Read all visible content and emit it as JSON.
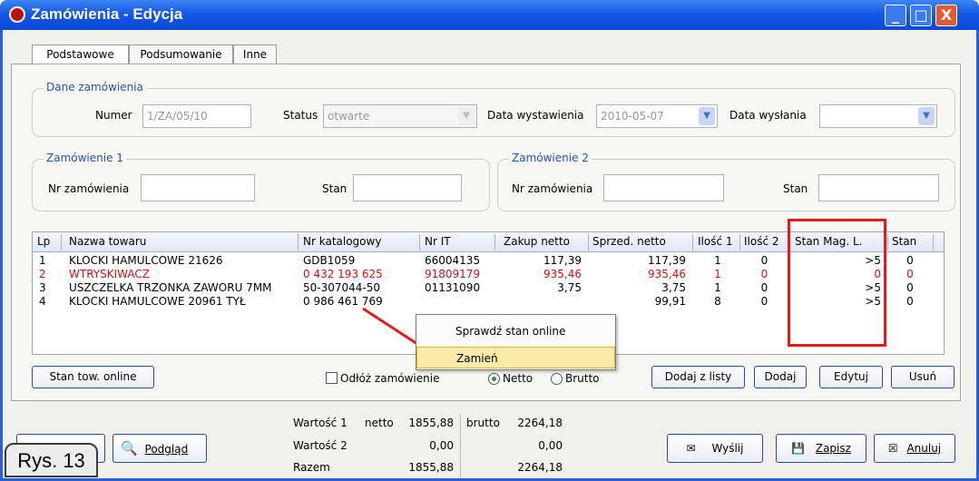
{
  "window": {
    "title": "Zamówienia - Edycja",
    "minimize": "_",
    "maximize": "□",
    "close": "X"
  },
  "tabs": [
    "Podstawowe",
    "Podsumowanie",
    "Inne"
  ],
  "dane": {
    "title": "Dane zamówienia",
    "numer_label": "Numer",
    "numer_value": "1/ZA/05/10",
    "status_label": "Status",
    "status_value": "otwarte",
    "data_wyst_label": "Data wystawienia",
    "data_wyst_value": "2010-05-07",
    "data_wysl_label": "Data wysłania",
    "data_wysl_value": ""
  },
  "zam1": {
    "title": "Zamówienie 1",
    "nr_label": "Nr zamówienia",
    "nr_value": "",
    "stan_label": "Stan",
    "stan_value": ""
  },
  "zam2": {
    "title": "Zamówienie 2",
    "nr_label": "Nr zamówienia",
    "nr_value": "",
    "stan_label": "Stan",
    "stan_value": ""
  },
  "table": {
    "headers": [
      "Lp",
      "Nazwa towaru",
      "Nr katalogowy",
      "Nr IT",
      "Zakup netto",
      "Sprzed. netto",
      "Ilość 1",
      "Ilość 2",
      "Stan Mag. L.",
      "Stan"
    ],
    "rows": [
      {
        "lp": "1",
        "nazwa": "KLOCKI HAMULCOWE     21626",
        "kat": "GDB1059",
        "it": "66004135",
        "zakup": "117,39",
        "sprzed": "117,39",
        "il1": "1",
        "il2": "0",
        "stan_mag": ">5",
        "stan": "0",
        "red": false
      },
      {
        "lp": "2",
        "nazwa": "WTRYSKIWACZ",
        "kat": "0 432 193 625",
        "it": "91809179",
        "zakup": "935,46",
        "sprzed": "935,46",
        "il1": "1",
        "il2": "0",
        "stan_mag": "0",
        "stan": "0",
        "red": true
      },
      {
        "lp": "3",
        "nazwa": "USZCZELKA TRZONKA ZAWORU 7MM",
        "kat": "50-307044-50",
        "it": "01131090",
        "zakup": "3,75",
        "sprzed": "3,75",
        "il1": "1",
        "il2": "0",
        "stan_mag": ">5",
        "stan": "0",
        "red": false
      },
      {
        "lp": "4",
        "nazwa": "KLOCKI HAMULCOWE     20961 TYŁ",
        "kat": "0 986 461 769",
        "it": "",
        "zakup": "",
        "sprzed": "99,91",
        "il1": "8",
        "il2": "0",
        "stan_mag": ">5",
        "stan": "0",
        "red": false
      }
    ]
  },
  "context_menu": {
    "items": [
      "Sprawdź stan online",
      "Zamień"
    ],
    "selected": 1
  },
  "actions": {
    "stan_online": "Stan tow. online",
    "odloz": "Odłóż zamówienie",
    "netto": "Netto",
    "brutto": "Brutto",
    "dodaj_z_listy": "Dodaj z listy",
    "dodaj": "Dodaj",
    "edytuj": "Edytuj",
    "usun": "Usuń"
  },
  "totals": {
    "w1": "Wartość 1",
    "w2": "Wartość 2",
    "razem": "Razem",
    "netto_label": "netto",
    "brutto_label": "brutto",
    "netto1": "1855,88",
    "netto2": "0,00",
    "netto3": "1855,88",
    "brutto1": "2264,18",
    "brutto2": "0,00",
    "brutto3": "2264,18"
  },
  "bottom": {
    "podglad": "Podgląd",
    "wyslij": "Wyślij",
    "zapisz": "Zapisz",
    "anuluj": "Anuluj"
  },
  "caption": "Rys. 13",
  "colors": {
    "accent": "#2a5fd7",
    "highlight": "#e51b1b",
    "red_text": "#d01010"
  }
}
